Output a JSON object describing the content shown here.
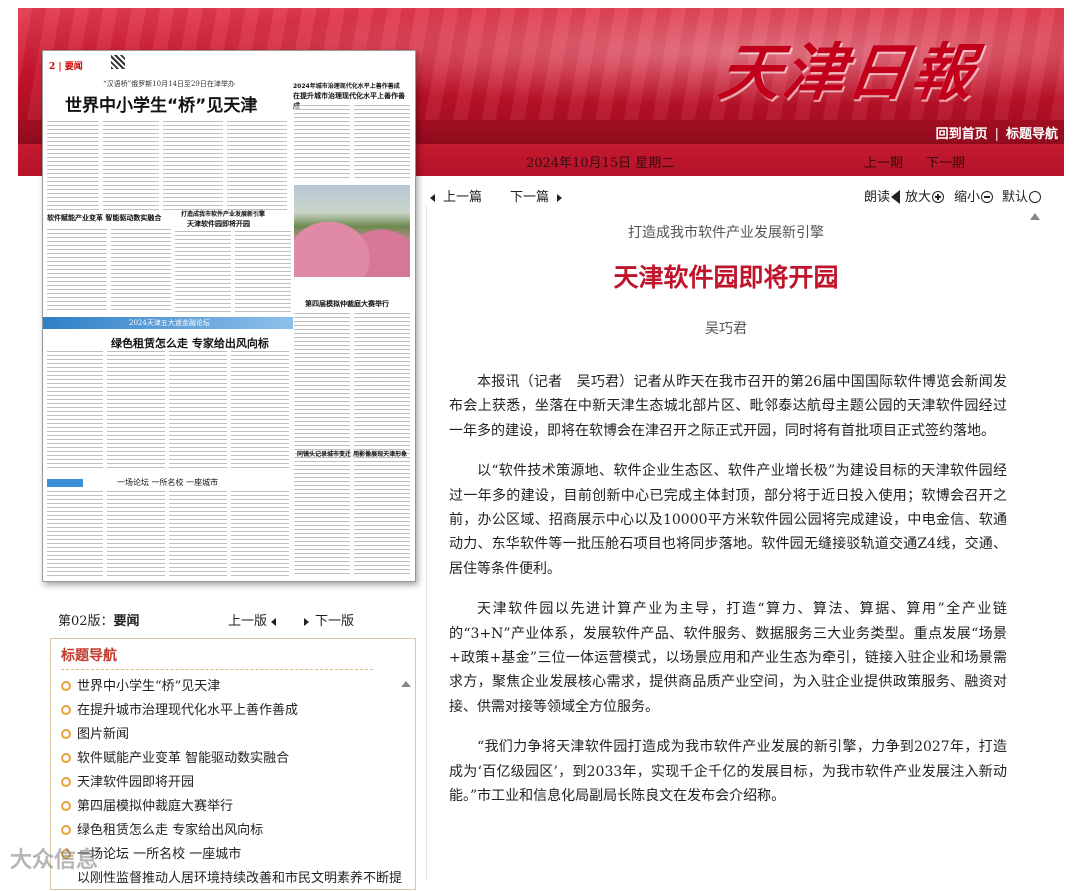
{
  "header": {
    "logo": "天津日報",
    "nav_home": "回到首页",
    "nav_sep": "|",
    "nav_titles": "标题导航",
    "date": "2024年10月15日 星期二",
    "prev_page": "上一期",
    "next_page": "下一期"
  },
  "thumbnail": {
    "page_no": "2 | 要闻",
    "subhead": "“汉语桥”俄罗斯10月14日至29日在津举办",
    "headline": "世界中小学生“桥”见天津",
    "h_a": "2024年城市治理现代化水平上善作善成",
    "h_b": "在提升城市治理现代化水平上善作善成",
    "h_c": "软件赋能产业变革 智能驱动数实融合",
    "h_d": "打造成我市软件产业发展新引擎",
    "h_e": "天津软件园即将开园",
    "h_f": "第四届模拟仲裁庭大赛举行",
    "h_g": "2024天津五大道金融论坛",
    "h_h": "绿色租赁怎么走 专家给出风向标",
    "h_i": "一场论坛 一所名校 一座城市",
    "h_j": "同镜头记录城市变迁 用影像展现天津形象"
  },
  "pager": {
    "label": "第02版：",
    "section": "要闻",
    "prev": "上一版",
    "next": "下一版"
  },
  "title_nav": {
    "heading": "标题导航",
    "items": [
      "世界中小学生“桥”见天津",
      "在提升城市治理现代化水平上善作善成",
      "图片新闻",
      "软件赋能产业变革  智能驱动数实融合",
      "天津软件园即将开园",
      "第四届模拟仲裁庭大赛举行",
      "绿色租赁怎么走  专家给出风向标",
      "一场论坛  一所名校  一座城市",
      "以刚性监督推动人居环境持续改善和市民文明素养不断提"
    ]
  },
  "toolbar": {
    "prev_article": "上一篇",
    "next_article": "下一篇",
    "read_aloud": "朗读",
    "zoom_in": "放大",
    "zoom_out": "缩小",
    "default": "默认"
  },
  "article": {
    "kicker": "打造成我市软件产业发展新引擎",
    "title": "天津软件园即将开园",
    "author": "吴巧君",
    "paragraphs": [
      "本报讯（记者　吴巧君）记者从昨天在我市召开的第26届中国国际软件博览会新闻发布会上获悉，坐落在中新天津生态城北部片区、毗邻泰达航母主题公园的天津软件园经过一年多的建设，即将在软博会在津召开之际正式开园，同时将有首批项目正式签约落地。",
      "以“软件技术策源地、软件企业生态区、软件产业增长极”为建设目标的天津软件园经过一年多的建设，目前创新中心已完成主体封顶，部分将于近日投入使用；软博会召开之前，办公区域、招商展示中心以及10000平方米软件园公园将完成建设，中电金信、软通动力、东华软件等一批压舱石项目也将同步落地。软件园无缝接驳轨道交通Z4线，交通、居住等条件便利。",
      "天津软件园以先进计算产业为主导，打造“算力、算法、算据、算用”全产业链的“3+N”产业体系，发展软件产品、软件服务、数据服务三大业务类型。重点发展“场景+政策+基金”三位一体运营模式，以场景应用和产业生态为牵引，链接入驻企业和场景需求方，聚焦企业发展核心需求，提供商品质产业空间，为入驻企业提供政策服务、融资对接、供需对接等领域全方位服务。",
      "“我们力争将天津软件园打造成为我市软件产业发展的新引擎，力争到2027年，打造成为‘百亿级园区’，到2033年，实现千企千亿的发展目标，为我市软件产业发展注入新动能。”市工业和信息化局副局长陈良文在发布会介绍称。"
    ]
  },
  "watermark": "大众信息"
}
